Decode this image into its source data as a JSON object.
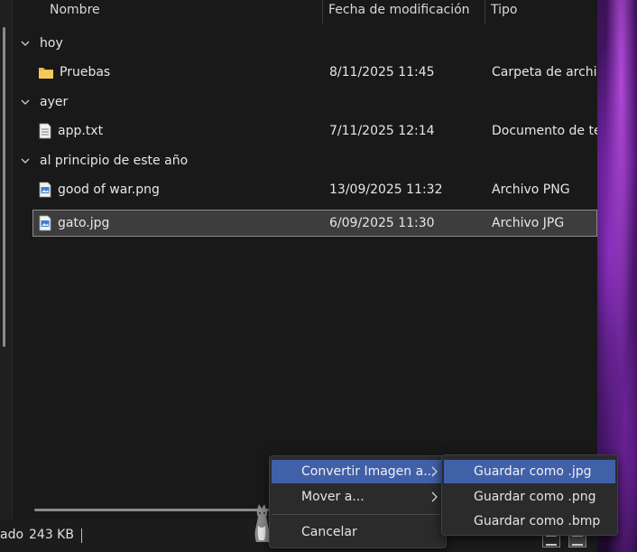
{
  "columns": {
    "name": "Nombre",
    "date": "Fecha de modificación",
    "type": "Tipo"
  },
  "groups": [
    {
      "label": "hoy"
    },
    {
      "label": "ayer"
    },
    {
      "label": "al principio de este año"
    }
  ],
  "files": [
    {
      "name": "Pruebas",
      "date": "8/11/2025 11:45",
      "type": "Carpeta de archivos",
      "icon": "folder-icon"
    },
    {
      "name": "app.txt",
      "date": "7/11/2025 12:14",
      "type": "Documento de texto",
      "icon": "text-file-icon"
    },
    {
      "name": "good of war.png",
      "date": "13/09/2025 11:32",
      "type": "Archivo PNG",
      "icon": "image-file-icon"
    },
    {
      "name": "gato.jpg",
      "date": "6/09/2025 11:30",
      "type": "Archivo JPG",
      "icon": "image-file-icon",
      "selected": true
    }
  ],
  "status": {
    "selection_text": "ado",
    "size": "243 KB"
  },
  "context_menu": {
    "items": [
      {
        "label": "Convertir Imagen a...",
        "submenu": true,
        "highlighted": true
      },
      {
        "label": "Mover a...",
        "submenu": true
      },
      {
        "label": "Cancelar"
      }
    ]
  },
  "submenu": {
    "items": [
      {
        "label": "Guardar como .jpg",
        "highlighted": true
      },
      {
        "label": "Guardar como .png"
      },
      {
        "label": "Guardar como .bmp"
      }
    ]
  },
  "colors": {
    "highlight": "#4060a8",
    "folder": "#e8b84a",
    "background": "#191919"
  }
}
